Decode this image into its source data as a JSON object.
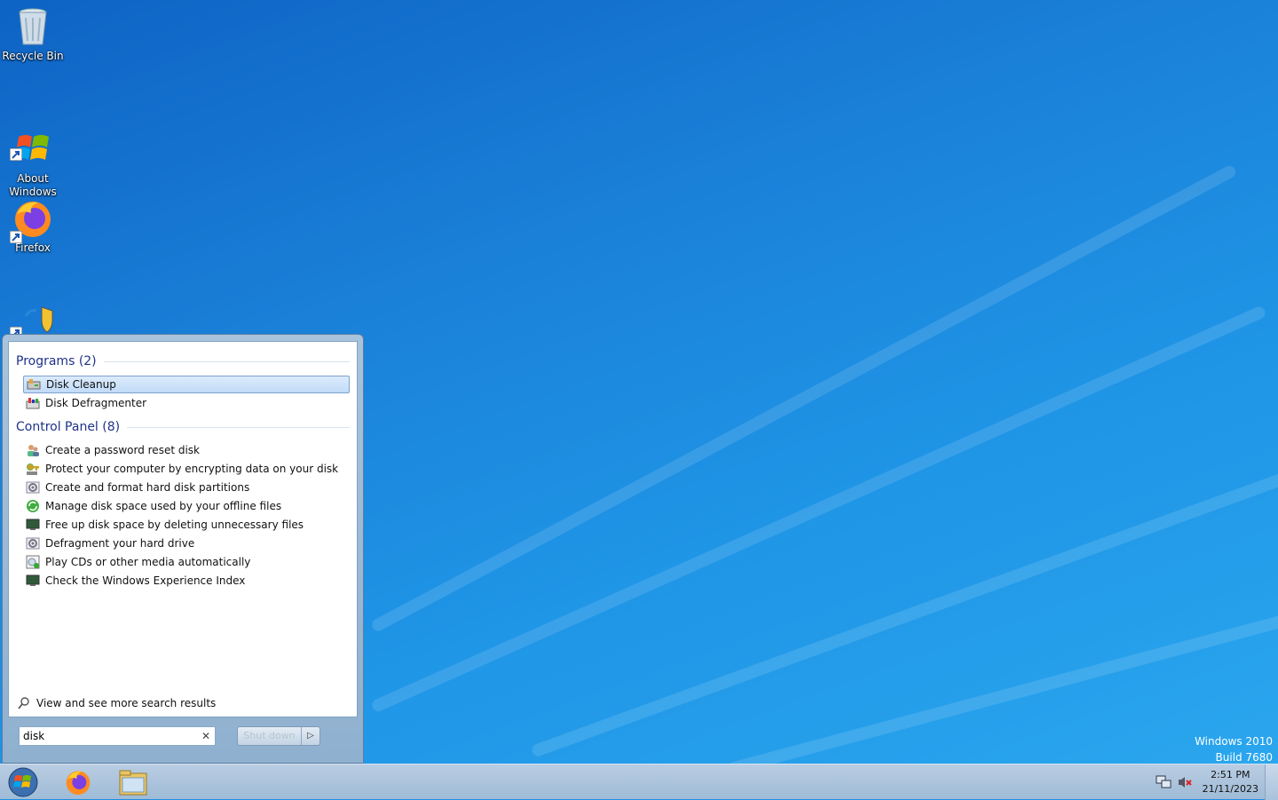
{
  "desktop": {
    "icons": [
      {
        "label": "Recycle Bin",
        "icon": "recycle-bin-icon"
      },
      {
        "label": "About\nWindows",
        "icon": "windows-flag-icon"
      },
      {
        "label": "Firefox",
        "icon": "firefox-icon"
      },
      {
        "label": "",
        "icon": "shield-icon"
      }
    ]
  },
  "start_menu": {
    "groups": [
      {
        "title": "Programs (2)",
        "items": [
          {
            "label": "Disk Cleanup",
            "icon": "disk-cleanup-icon",
            "selected": true
          },
          {
            "label": "Disk Defragmenter",
            "icon": "disk-defragmenter-icon",
            "selected": false
          }
        ]
      },
      {
        "title": "Control Panel (8)",
        "items": [
          {
            "label": "Create a password reset disk",
            "icon": "users-icon"
          },
          {
            "label": "Protect your computer by encrypting data on your disk",
            "icon": "key-icon"
          },
          {
            "label": "Create and format hard disk partitions",
            "icon": "admin-tools-icon"
          },
          {
            "label": "Manage disk space used by your offline files",
            "icon": "sync-icon"
          },
          {
            "label": "Free up disk space by deleting unnecessary files",
            "icon": "monitor-icon"
          },
          {
            "label": "Defragment your hard drive",
            "icon": "admin-tools-icon"
          },
          {
            "label": "Play CDs or other media automatically",
            "icon": "autoplay-icon"
          },
          {
            "label": "Check the Windows Experience Index",
            "icon": "monitor-icon"
          }
        ]
      }
    ],
    "see_more": "View and see more search results",
    "search": {
      "value": "disk",
      "placeholder": ""
    },
    "shutdown_label": "Shut down",
    "shutdown_arrow": "▷"
  },
  "taskbar": {
    "pinned": [
      "start-orb-icon",
      "firefox-icon",
      "file-explorer-icon"
    ],
    "clock": {
      "time": "2:51 PM",
      "date": "21/11/2023"
    }
  },
  "watermark": {
    "line1": "Windows 2010",
    "line2": "Build 7680"
  },
  "colors": {
    "accent": "#1e3287",
    "selection": "#c1dbf8",
    "desktop": "#1f8fe0"
  }
}
